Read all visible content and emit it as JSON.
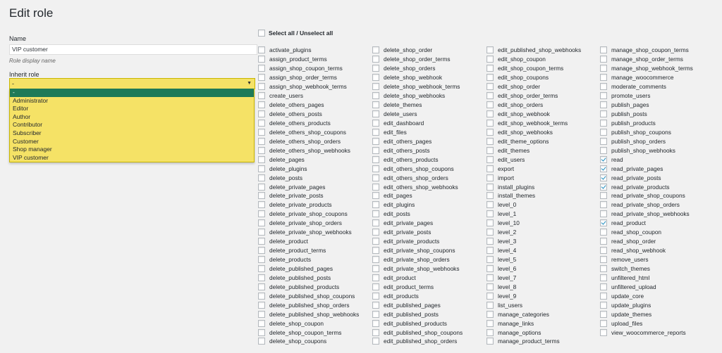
{
  "page_title": "Edit role",
  "name_field": {
    "label": "Name",
    "value": "VIP customer",
    "hint": "Role display name"
  },
  "inherit": {
    "label": "Inherit role",
    "selected": "-",
    "options": [
      "-",
      "Administrator",
      "Editor",
      "Author",
      "Contributor",
      "Subscriber",
      "Customer",
      "Shop manager",
      "VIP customer"
    ]
  },
  "select_all_label": "Select all / Unselect all",
  "columns": [
    [
      {
        "label": "activate_plugins",
        "checked": false
      },
      {
        "label": "assign_product_terms",
        "checked": false
      },
      {
        "label": "assign_shop_coupon_terms",
        "checked": false
      },
      {
        "label": "assign_shop_order_terms",
        "checked": false
      },
      {
        "label": "assign_shop_webhook_terms",
        "checked": false
      },
      {
        "label": "create_users",
        "checked": false
      },
      {
        "label": "delete_others_pages",
        "checked": false
      },
      {
        "label": "delete_others_posts",
        "checked": false
      },
      {
        "label": "delete_others_products",
        "checked": false
      },
      {
        "label": "delete_others_shop_coupons",
        "checked": false
      },
      {
        "label": "delete_others_shop_orders",
        "checked": false
      },
      {
        "label": "delete_others_shop_webhooks",
        "checked": false
      },
      {
        "label": "delete_pages",
        "checked": false
      },
      {
        "label": "delete_plugins",
        "checked": false
      },
      {
        "label": "delete_posts",
        "checked": false
      },
      {
        "label": "delete_private_pages",
        "checked": false
      },
      {
        "label": "delete_private_posts",
        "checked": false
      },
      {
        "label": "delete_private_products",
        "checked": false
      },
      {
        "label": "delete_private_shop_coupons",
        "checked": false
      },
      {
        "label": "delete_private_shop_orders",
        "checked": false
      },
      {
        "label": "delete_private_shop_webhooks",
        "checked": false
      },
      {
        "label": "delete_product",
        "checked": false
      },
      {
        "label": "delete_product_terms",
        "checked": false
      },
      {
        "label": "delete_products",
        "checked": false
      },
      {
        "label": "delete_published_pages",
        "checked": false
      },
      {
        "label": "delete_published_posts",
        "checked": false
      },
      {
        "label": "delete_published_products",
        "checked": false
      },
      {
        "label": "delete_published_shop_coupons",
        "checked": false
      },
      {
        "label": "delete_published_shop_orders",
        "checked": false
      },
      {
        "label": "delete_published_shop_webhooks",
        "checked": false
      },
      {
        "label": "delete_shop_coupon",
        "checked": false
      },
      {
        "label": "delete_shop_coupon_terms",
        "checked": false
      },
      {
        "label": "delete_shop_coupons",
        "checked": false
      }
    ],
    [
      {
        "label": "delete_shop_order",
        "checked": false
      },
      {
        "label": "delete_shop_order_terms",
        "checked": false
      },
      {
        "label": "delete_shop_orders",
        "checked": false
      },
      {
        "label": "delete_shop_webhook",
        "checked": false
      },
      {
        "label": "delete_shop_webhook_terms",
        "checked": false
      },
      {
        "label": "delete_shop_webhooks",
        "checked": false
      },
      {
        "label": "delete_themes",
        "checked": false
      },
      {
        "label": "delete_users",
        "checked": false
      },
      {
        "label": "edit_dashboard",
        "checked": false
      },
      {
        "label": "edit_files",
        "checked": false
      },
      {
        "label": "edit_others_pages",
        "checked": false
      },
      {
        "label": "edit_others_posts",
        "checked": false
      },
      {
        "label": "edit_others_products",
        "checked": false
      },
      {
        "label": "edit_others_shop_coupons",
        "checked": false
      },
      {
        "label": "edit_others_shop_orders",
        "checked": false
      },
      {
        "label": "edit_others_shop_webhooks",
        "checked": false
      },
      {
        "label": "edit_pages",
        "checked": false
      },
      {
        "label": "edit_plugins",
        "checked": false
      },
      {
        "label": "edit_posts",
        "checked": false
      },
      {
        "label": "edit_private_pages",
        "checked": false
      },
      {
        "label": "edit_private_posts",
        "checked": false
      },
      {
        "label": "edit_private_products",
        "checked": false
      },
      {
        "label": "edit_private_shop_coupons",
        "checked": false
      },
      {
        "label": "edit_private_shop_orders",
        "checked": false
      },
      {
        "label": "edit_private_shop_webhooks",
        "checked": false
      },
      {
        "label": "edit_product",
        "checked": false
      },
      {
        "label": "edit_product_terms",
        "checked": false
      },
      {
        "label": "edit_products",
        "checked": false
      },
      {
        "label": "edit_published_pages",
        "checked": false
      },
      {
        "label": "edit_published_posts",
        "checked": false
      },
      {
        "label": "edit_published_products",
        "checked": false
      },
      {
        "label": "edit_published_shop_coupons",
        "checked": false
      },
      {
        "label": "edit_published_shop_orders",
        "checked": false
      }
    ],
    [
      {
        "label": "edit_published_shop_webhooks",
        "checked": false
      },
      {
        "label": "edit_shop_coupon",
        "checked": false
      },
      {
        "label": "edit_shop_coupon_terms",
        "checked": false
      },
      {
        "label": "edit_shop_coupons",
        "checked": false
      },
      {
        "label": "edit_shop_order",
        "checked": false
      },
      {
        "label": "edit_shop_order_terms",
        "checked": false
      },
      {
        "label": "edit_shop_orders",
        "checked": false
      },
      {
        "label": "edit_shop_webhook",
        "checked": false
      },
      {
        "label": "edit_shop_webhook_terms",
        "checked": false
      },
      {
        "label": "edit_shop_webhooks",
        "checked": false
      },
      {
        "label": "edit_theme_options",
        "checked": false
      },
      {
        "label": "edit_themes",
        "checked": false
      },
      {
        "label": "edit_users",
        "checked": false
      },
      {
        "label": "export",
        "checked": false
      },
      {
        "label": "import",
        "checked": false
      },
      {
        "label": "install_plugins",
        "checked": false
      },
      {
        "label": "install_themes",
        "checked": false
      },
      {
        "label": "level_0",
        "checked": false
      },
      {
        "label": "level_1",
        "checked": false
      },
      {
        "label": "level_10",
        "checked": false
      },
      {
        "label": "level_2",
        "checked": false
      },
      {
        "label": "level_3",
        "checked": false
      },
      {
        "label": "level_4",
        "checked": false
      },
      {
        "label": "level_5",
        "checked": false
      },
      {
        "label": "level_6",
        "checked": false
      },
      {
        "label": "level_7",
        "checked": false
      },
      {
        "label": "level_8",
        "checked": false
      },
      {
        "label": "level_9",
        "checked": false
      },
      {
        "label": "list_users",
        "checked": false
      },
      {
        "label": "manage_categories",
        "checked": false
      },
      {
        "label": "manage_links",
        "checked": false
      },
      {
        "label": "manage_options",
        "checked": false
      },
      {
        "label": "manage_product_terms",
        "checked": false
      }
    ],
    [
      {
        "label": "manage_shop_coupon_terms",
        "checked": false
      },
      {
        "label": "manage_shop_order_terms",
        "checked": false
      },
      {
        "label": "manage_shop_webhook_terms",
        "checked": false
      },
      {
        "label": "manage_woocommerce",
        "checked": false
      },
      {
        "label": "moderate_comments",
        "checked": false
      },
      {
        "label": "promote_users",
        "checked": false
      },
      {
        "label": "publish_pages",
        "checked": false
      },
      {
        "label": "publish_posts",
        "checked": false
      },
      {
        "label": "publish_products",
        "checked": false
      },
      {
        "label": "publish_shop_coupons",
        "checked": false
      },
      {
        "label": "publish_shop_orders",
        "checked": false
      },
      {
        "label": "publish_shop_webhooks",
        "checked": false
      },
      {
        "label": "read",
        "checked": true
      },
      {
        "label": "read_private_pages",
        "checked": true
      },
      {
        "label": "read_private_posts",
        "checked": true
      },
      {
        "label": "read_private_products",
        "checked": true
      },
      {
        "label": "read_private_shop_coupons",
        "checked": false
      },
      {
        "label": "read_private_shop_orders",
        "checked": false
      },
      {
        "label": "read_private_shop_webhooks",
        "checked": false
      },
      {
        "label": "read_product",
        "checked": true
      },
      {
        "label": "read_shop_coupon",
        "checked": false
      },
      {
        "label": "read_shop_order",
        "checked": false
      },
      {
        "label": "read_shop_webhook",
        "checked": false
      },
      {
        "label": "remove_users",
        "checked": false
      },
      {
        "label": "switch_themes",
        "checked": false
      },
      {
        "label": "unfiltered_html",
        "checked": false
      },
      {
        "label": "unfiltered_upload",
        "checked": false
      },
      {
        "label": "update_core",
        "checked": false
      },
      {
        "label": "update_plugins",
        "checked": false
      },
      {
        "label": "update_themes",
        "checked": false
      },
      {
        "label": "upload_files",
        "checked": false
      },
      {
        "label": "view_woocommerce_reports",
        "checked": false
      }
    ]
  ]
}
